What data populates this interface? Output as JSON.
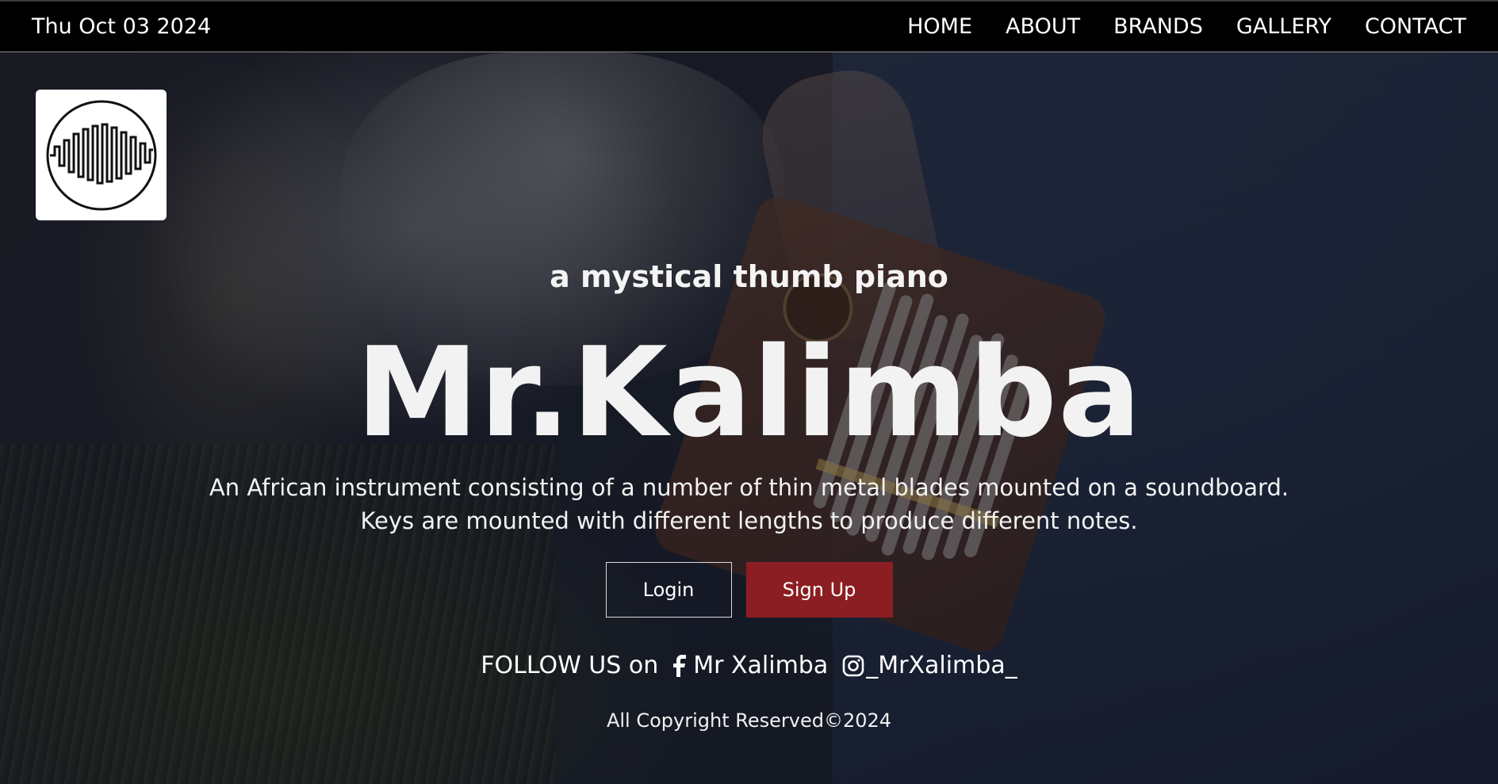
{
  "header": {
    "date": "Thu Oct 03 2024",
    "nav": [
      {
        "label": "HOME"
      },
      {
        "label": "ABOUT"
      },
      {
        "label": "BRANDS"
      },
      {
        "label": "GALLERY"
      },
      {
        "label": "CONTACT"
      }
    ]
  },
  "hero": {
    "tagline": "a mystical thumb piano",
    "brand": "Mr.Kalimba",
    "description_line1": "An African instrument consisting of a number of thin metal blades mounted on a soundboard.",
    "description_line2": "Keys are mounted with different lengths to produce different notes.",
    "buttons": {
      "login": "Login",
      "signup": "Sign Up"
    }
  },
  "follow": {
    "label": "FOLLOW US on",
    "facebook": {
      "icon": "facebook-icon",
      "handle": "Mr Xalimba"
    },
    "instagram": {
      "icon": "instagram-icon",
      "handle": "_MrXalimba_"
    }
  },
  "footer": {
    "copyright": "All Copyright Reserved©2024"
  },
  "colors": {
    "topbar": "#000000",
    "signup_button": "#8b1e22",
    "text": "#ffffff"
  }
}
